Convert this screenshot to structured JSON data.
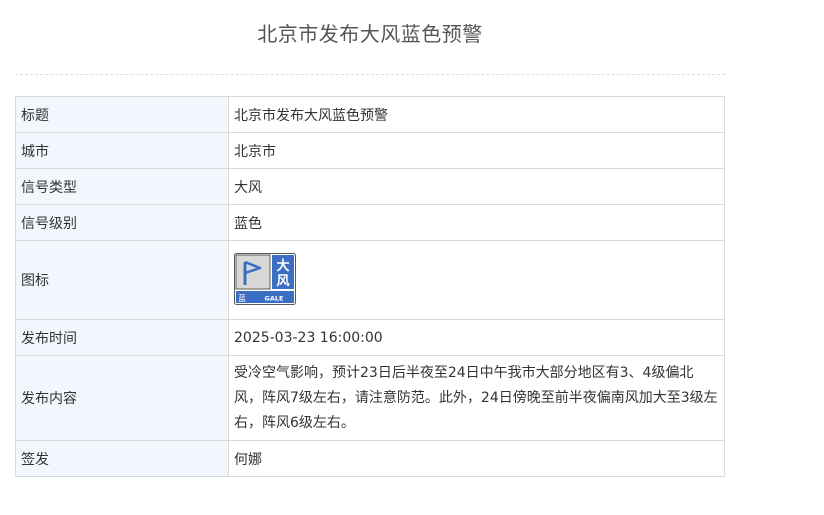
{
  "page": {
    "title": "北京市发布大风蓝色预警"
  },
  "table": {
    "rows": [
      {
        "label": "标题",
        "value": "北京市发布大风蓝色预警"
      },
      {
        "label": "城市",
        "value": "北京市"
      },
      {
        "label": "信号类型",
        "value": "大风"
      },
      {
        "label": "信号级别",
        "value": "蓝色"
      },
      {
        "label": "图标",
        "value": ""
      },
      {
        "label": "发布时间",
        "value": "2025-03-23 16:00:00"
      },
      {
        "label": "发布内容",
        "value": "受冷空气影响，预计23日后半夜至24日中午我市大部分地区有3、4级偏北风，阵风7级左右，请注意防范。此外，24日傍晚至前半夜偏南风加大至3级左右，阵风6级左右。"
      },
      {
        "label": "签发",
        "value": "何娜"
      }
    ]
  },
  "icon": {
    "name": "gale-blue-warning-icon",
    "char_top": "大",
    "char_bottom": "风",
    "level_char": "蓝",
    "english": "GALE",
    "color_main": "#3a6fc4",
    "color_panel": "#d8d8d8",
    "color_border": "#5b5b5b"
  }
}
